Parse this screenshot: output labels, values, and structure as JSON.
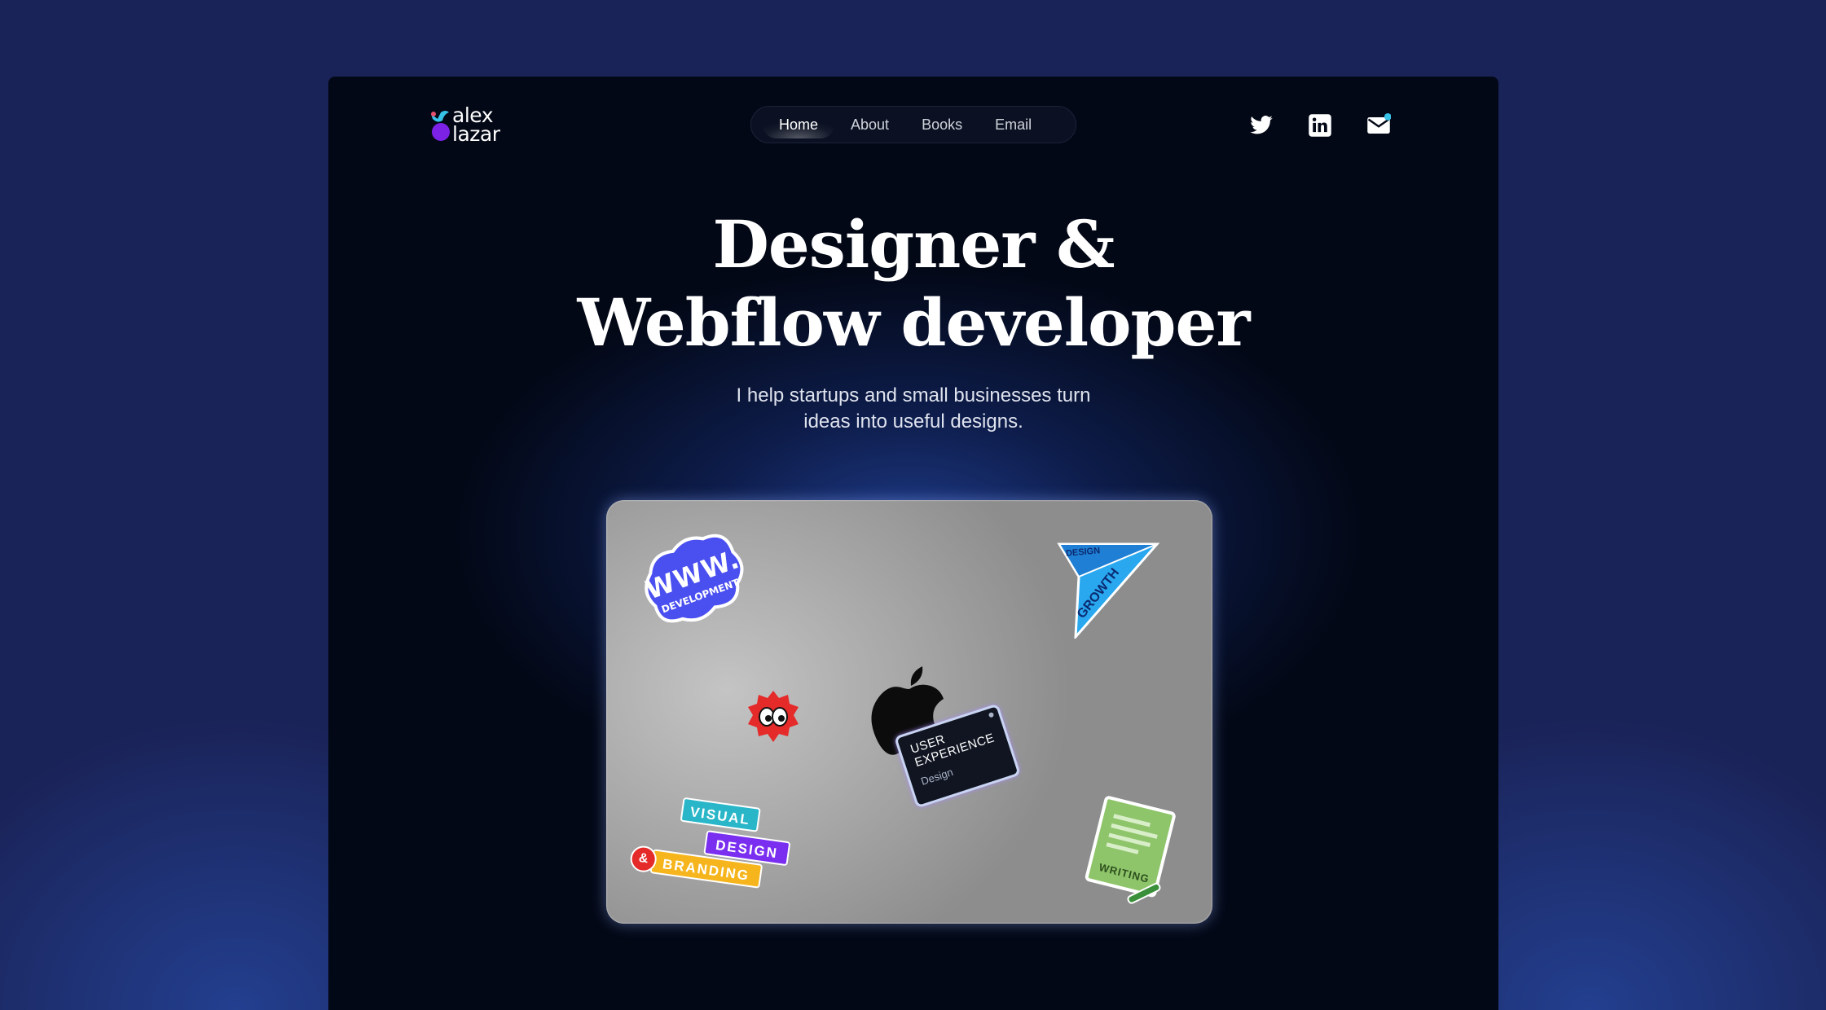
{
  "logo": {
    "line1": "alex",
    "line2": "lazar"
  },
  "nav": {
    "items": [
      "Home",
      "About",
      "Books",
      "Email"
    ],
    "active": "Home"
  },
  "social": [
    "twitter-icon",
    "linkedin-icon",
    "mail-icon"
  ],
  "hero": {
    "title_line1": "Designer &",
    "title_line2": "Webflow developer",
    "subtitle_line1": "I help startups and small businesses turn",
    "subtitle_line2": "ideas into useful designs."
  },
  "stickers": {
    "www": {
      "main": "WWW.",
      "sub": "DEVELOPMENT"
    },
    "growth": {
      "top": "DESIGN",
      "side": "GROWTH"
    },
    "ux": {
      "line1": "USER",
      "line2": "EXPERIENCE",
      "line3": "Design"
    },
    "branding": {
      "visual": "VISUAL",
      "design": "DESIGN",
      "amp": "&",
      "branding": "BRANDING"
    },
    "writing": {
      "label": "WRITING"
    }
  },
  "colors": {
    "page_bg": "#1a2358",
    "frame_bg": "#030816",
    "www_blue": "#4a4ff0",
    "growth_blue": "#29a8f0",
    "visual_teal": "#29b6c8",
    "design_purple": "#7a2ff0",
    "branding_yellow": "#f6b51c",
    "amp_red": "#e52a2a",
    "writing_green": "#8ec46a"
  }
}
